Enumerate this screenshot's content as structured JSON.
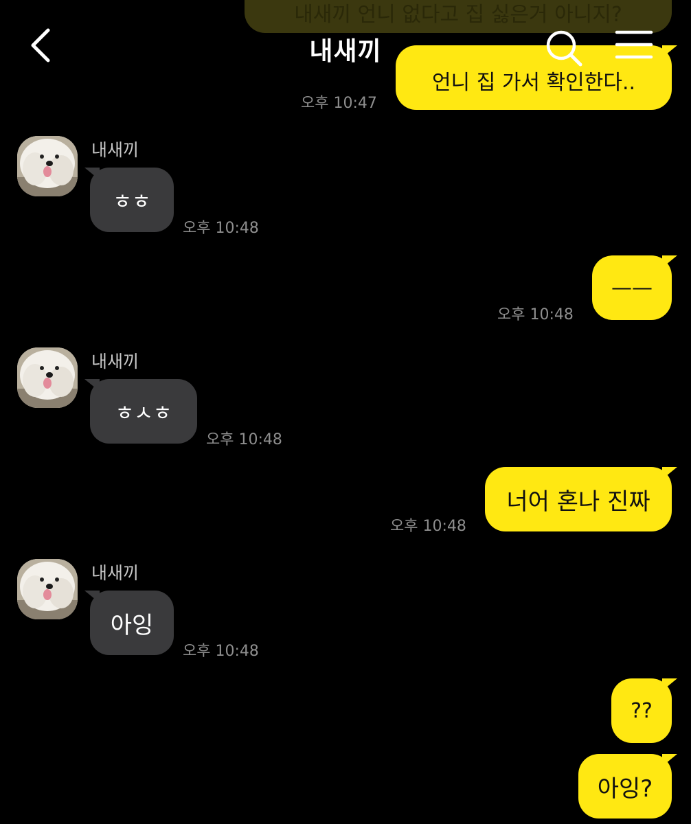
{
  "header": {
    "title": "내새끼",
    "back_icon": "chevron-left-icon",
    "search_icon": "search-icon",
    "menu_icon": "menu-icon"
  },
  "colors": {
    "background": "#000000",
    "my_bubble": "#ffe812",
    "their_bubble": "#3a3a3c",
    "timestamp": "#8e8e8e"
  },
  "messages": [
    {
      "from": "me",
      "text": "내새끼 언니 없다고 집 싫은거 아니지?",
      "time": ""
    },
    {
      "from": "me",
      "text": "언니 집 가서 확인한다..",
      "time": "오후 10:47"
    },
    {
      "from": "other",
      "sender": "내새끼",
      "text": "ㅎㅎ",
      "time": "오후 10:48"
    },
    {
      "from": "me",
      "text": "——",
      "time": "오후 10:48"
    },
    {
      "from": "other",
      "sender": "내새끼",
      "text": "ㅎㅅㅎ",
      "time": "오후 10:48"
    },
    {
      "from": "me",
      "text": "너어 혼나 진짜",
      "time": "오후 10:48"
    },
    {
      "from": "other",
      "sender": "내새끼",
      "text": "아잉",
      "time": "오후 10:48"
    },
    {
      "from": "me",
      "text": "??",
      "time": ""
    },
    {
      "from": "me",
      "text": "아잉?",
      "time": ""
    }
  ]
}
